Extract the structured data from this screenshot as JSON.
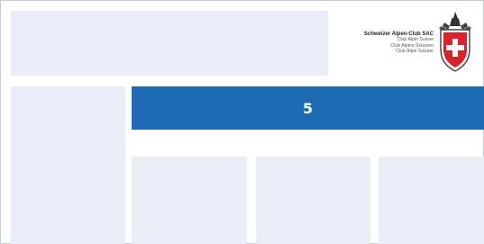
{
  "logo": {
    "line1": "Schweizer Alpen-Club SAC",
    "line2": "Club Alpin Suisse",
    "line3": "Club Alpino Svizzero",
    "line4": "Club Alpin Svizzer",
    "crest_icon": "sac-crest-icon"
  },
  "banner": {
    "label": "5"
  },
  "colors": {
    "accent": "#1f6cb4",
    "panel": "#e8edf7",
    "crest_red": "#d8232a"
  }
}
